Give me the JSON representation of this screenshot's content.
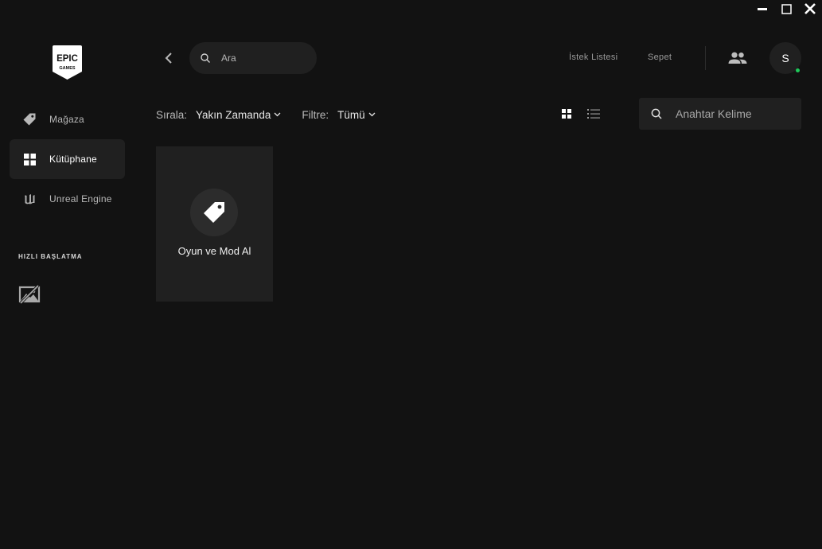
{
  "window": {
    "controls": [
      "minimize-icon",
      "maximize-icon",
      "close-icon"
    ]
  },
  "sidebar": {
    "logo": {
      "line1": "EPIC",
      "line2": "GAMES"
    },
    "items": [
      {
        "label": "Mağaza",
        "icon": "tag-icon",
        "active": false
      },
      {
        "label": "Kütüphane",
        "icon": "grid-icon",
        "active": true
      },
      {
        "label": "Unreal Engine",
        "icon": "unreal-icon",
        "active": false
      }
    ],
    "quick_launch_title": "HIZLI BAŞLATMA"
  },
  "topbar": {
    "search_placeholder": "Ara",
    "wishlist_label": "İstek Listesi",
    "cart_label": "Sepet",
    "avatar_initial": "S",
    "status_color": "#1ec95a"
  },
  "library": {
    "sort_key": "Sırala:",
    "sort_value": "Yakın Zamanda",
    "filter_key": "Filtre:",
    "filter_value": "Tümü",
    "keyword_placeholder": "Anahtar Kelime",
    "card_label": "Oyun ve Mod Al"
  },
  "colors": {
    "background": "#121212",
    "surface": "#202020",
    "accent_online": "#1ec95a"
  }
}
